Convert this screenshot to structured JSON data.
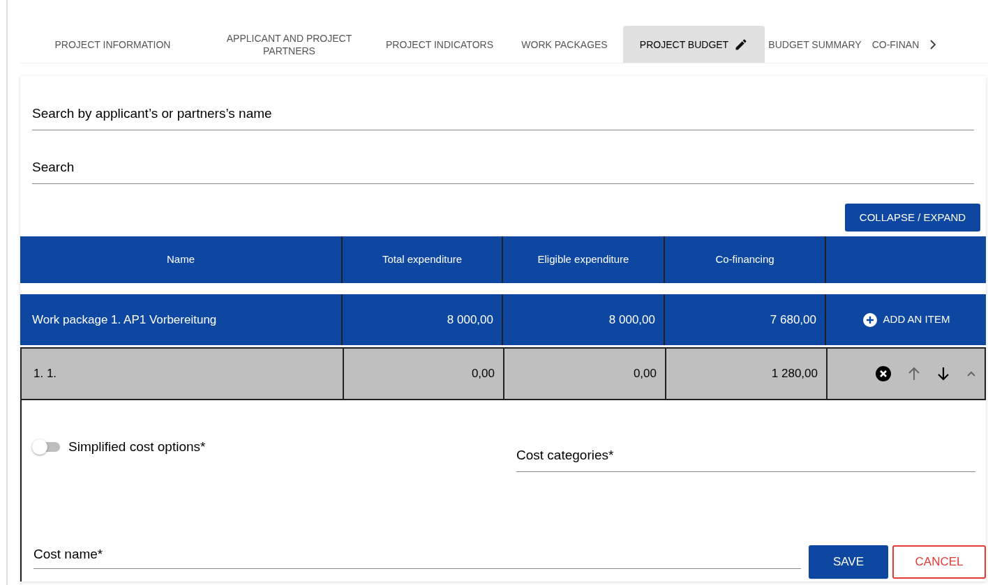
{
  "tabs": [
    {
      "label": "PROJECT INFORMATION",
      "selected": false,
      "editing": false
    },
    {
      "label": "APPLICANT AND PROJECT PARTNERS",
      "selected": false,
      "editing": false
    },
    {
      "label": "PROJECT INDICATORS",
      "selected": false,
      "editing": false
    },
    {
      "label": "WORK PACKAGES",
      "selected": false,
      "editing": false
    },
    {
      "label": "PROJECT BUDGET",
      "selected": true,
      "editing": true
    },
    {
      "label": "BUDGET SUMMARY",
      "selected": false,
      "editing": false
    },
    {
      "label": "CO-FINAN",
      "selected": false,
      "editing": false
    }
  ],
  "partner_search": {
    "placeholder": "Search by applicant’s or partners’s name"
  },
  "search": {
    "placeholder": "Search"
  },
  "collapse_button": "COLLAPSE / EXPAND",
  "table": {
    "columns": [
      "Name",
      "Total expenditure",
      "Eligible expenditure",
      "Co-financing"
    ],
    "work_package": {
      "cells": [
        "Work package 1. AP1 Vorbereitung",
        "8 000,00",
        "8 000,00",
        "7 680,00"
      ],
      "action": "ADD AN ITEM"
    },
    "item": {
      "cells": [
        "1. 1.",
        "0,00",
        "0,00",
        "1 280,00"
      ],
      "expanded": true
    },
    "form": {
      "simplified_cost_options": {
        "label": "Simplified cost options*",
        "on": false
      },
      "cost_categories": {
        "placeholder": "Cost categories*"
      },
      "cost_name": {
        "placeholder": "Cost name*"
      }
    }
  },
  "buttons": {
    "save": "SAVE",
    "cancel": "CANCEL"
  }
}
